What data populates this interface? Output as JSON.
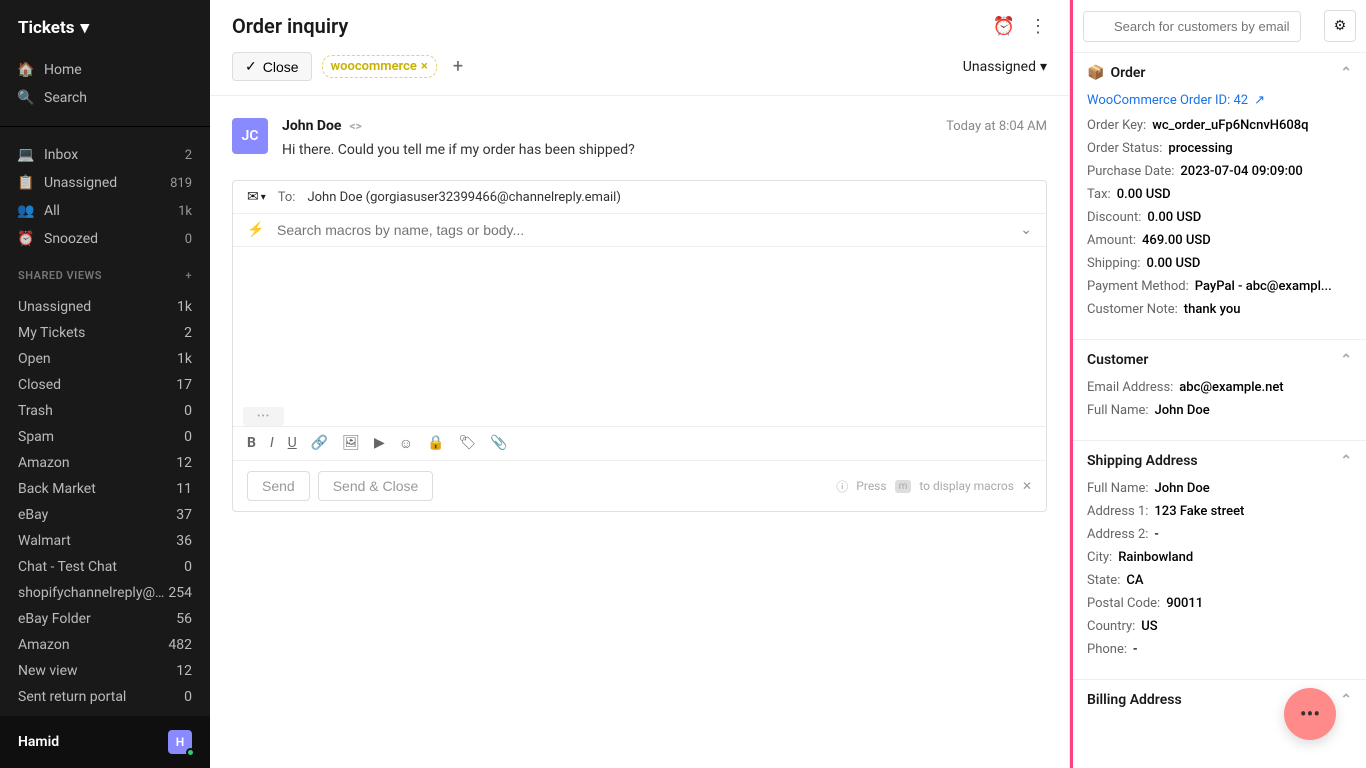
{
  "sidebar": {
    "header": "Tickets",
    "nav1": [
      {
        "icon": "home",
        "label": "Home",
        "count": ""
      },
      {
        "icon": "search",
        "label": "Search",
        "count": ""
      }
    ],
    "nav2": [
      {
        "icon": "inbox",
        "label": "Inbox",
        "count": "2"
      },
      {
        "icon": "unassigned",
        "label": "Unassigned",
        "count": "819"
      },
      {
        "icon": "all",
        "label": "All",
        "count": "1k"
      },
      {
        "icon": "snoozed",
        "label": "Snoozed",
        "count": "0"
      }
    ],
    "shared_header": "SHARED VIEWS",
    "shared": [
      {
        "label": "Unassigned",
        "count": "1k"
      },
      {
        "label": "My Tickets",
        "count": "2"
      },
      {
        "label": "Open",
        "count": "1k"
      },
      {
        "label": "Closed",
        "count": "17"
      },
      {
        "label": "Trash",
        "count": "0"
      },
      {
        "label": "Spam",
        "count": "0"
      },
      {
        "label": "Amazon",
        "count": "12"
      },
      {
        "label": "Back Market",
        "count": "11"
      },
      {
        "label": "eBay",
        "count": "37"
      },
      {
        "label": "Walmart",
        "count": "36"
      },
      {
        "label": "Chat - Test Chat",
        "count": "0"
      },
      {
        "label": "shopifychannelreply@gmail",
        "count": "254"
      },
      {
        "label": "eBay Folder",
        "count": "56"
      },
      {
        "label": "Amazon",
        "count": "482"
      },
      {
        "label": "New view",
        "count": "12"
      },
      {
        "label": "Sent return portal",
        "count": "0"
      }
    ],
    "footer_name": "Hamid",
    "footer_initial": "H"
  },
  "main": {
    "title": "Order inquiry",
    "close_label": "Close",
    "tag": "woocommerce",
    "assign_label": "Unassigned",
    "message": {
      "avatar": "JC",
      "sender": "John Doe",
      "time": "Today at 8:04 AM",
      "text": "Hi there. Could you tell me if my order has been shipped?"
    },
    "composer": {
      "to_label": "To:",
      "to_value": "John Doe (gorgiasuser32399466@channelreply.email)",
      "macro_placeholder": "Search macros by name, tags or body...",
      "send": "Send",
      "send_close": "Send & Close",
      "hint_prefix": "Press",
      "hint_key": "m",
      "hint_suffix": "to display macros"
    }
  },
  "right": {
    "search_placeholder": "Search for customers by email, order",
    "order": {
      "title": "Order",
      "link": "WooCommerce Order ID: 42",
      "fields": [
        {
          "k": "Order Key:",
          "v": "wc_order_uFp6NcnvH608q"
        },
        {
          "k": "Order Status:",
          "v": "processing"
        },
        {
          "k": "Purchase Date:",
          "v": "2023-07-04 09:09:00"
        },
        {
          "k": "Tax:",
          "v": "0.00 USD"
        },
        {
          "k": "Discount:",
          "v": "0.00 USD"
        },
        {
          "k": "Amount:",
          "v": "469.00 USD"
        },
        {
          "k": "Shipping:",
          "v": "0.00 USD"
        },
        {
          "k": "Payment Method:",
          "v": "PayPal - abc@exampl..."
        },
        {
          "k": "Customer Note:",
          "v": "thank you"
        }
      ]
    },
    "customer": {
      "title": "Customer",
      "fields": [
        {
          "k": "Email Address:",
          "v": "abc@example.net"
        },
        {
          "k": "Full Name:",
          "v": "John Doe"
        }
      ]
    },
    "shipping": {
      "title": "Shipping Address",
      "fields": [
        {
          "k": "Full Name:",
          "v": "John Doe"
        },
        {
          "k": "Address 1:",
          "v": "123 Fake street"
        },
        {
          "k": "Address 2:",
          "v": "-"
        },
        {
          "k": "City:",
          "v": "Rainbowland"
        },
        {
          "k": "State:",
          "v": "CA"
        },
        {
          "k": "Postal Code:",
          "v": "90011"
        },
        {
          "k": "Country:",
          "v": "US"
        },
        {
          "k": "Phone:",
          "v": "-"
        }
      ]
    },
    "billing_title": "Billing Address"
  }
}
